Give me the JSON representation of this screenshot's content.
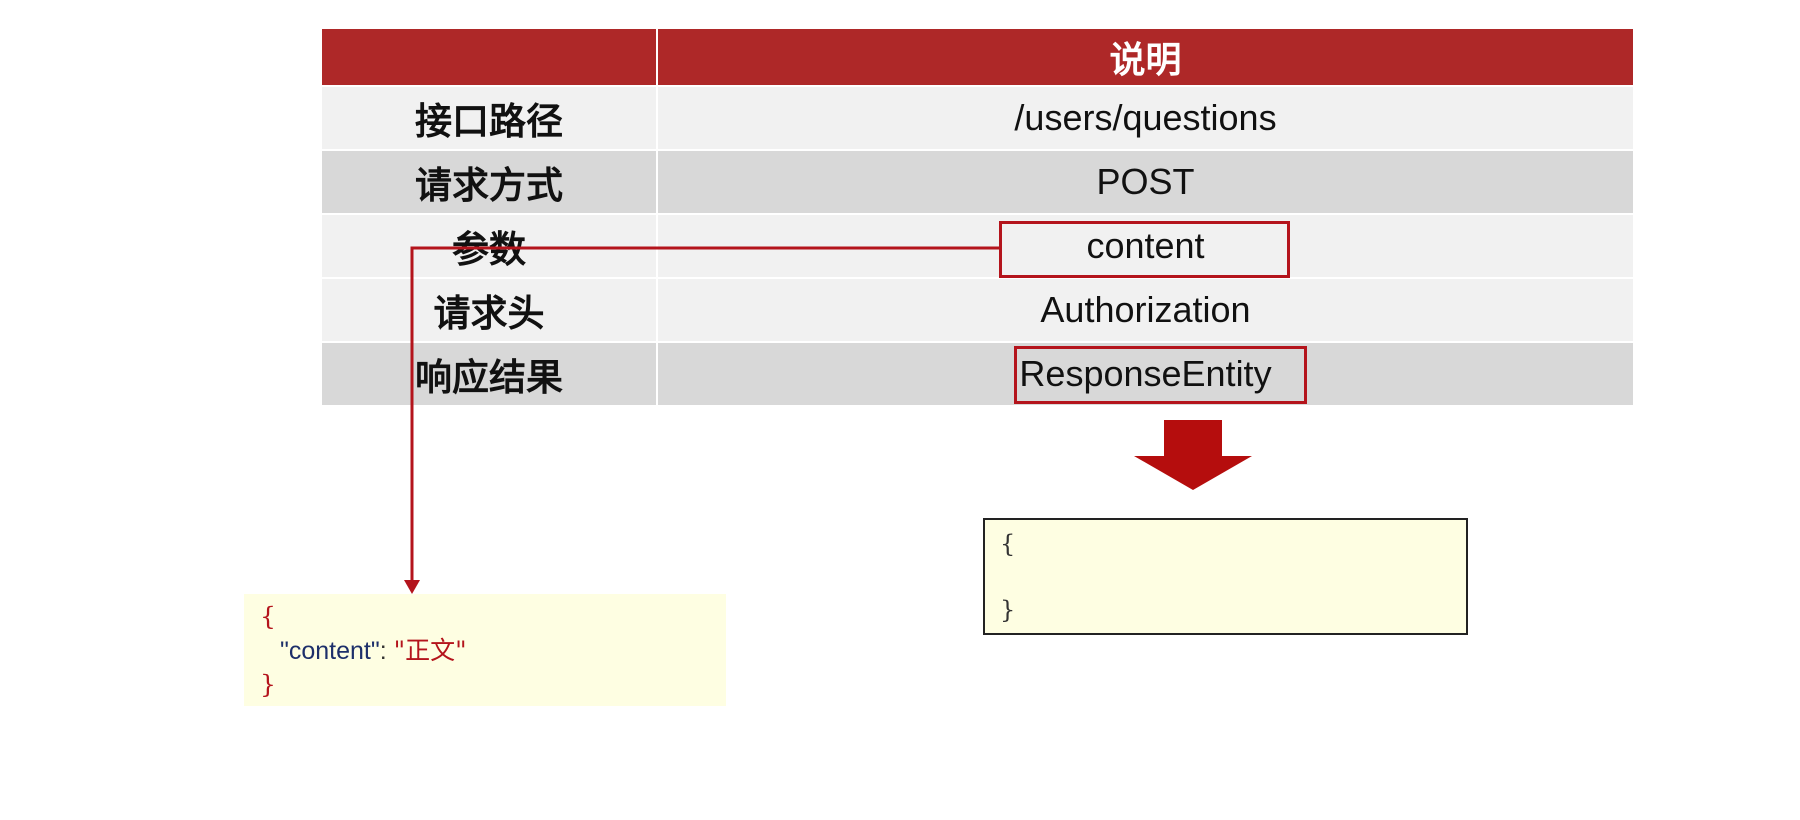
{
  "table": {
    "header_left": "",
    "header_right": "说明",
    "rows": [
      {
        "label": "接口路径",
        "value": "/users/questions"
      },
      {
        "label": "请求方式",
        "value": "POST"
      },
      {
        "label": "参数",
        "value": "content"
      },
      {
        "label": "请求头",
        "value": "Authorization"
      },
      {
        "label": "响应结果",
        "value": "ResponseEntity"
      }
    ]
  },
  "request_body": {
    "open_brace": "{",
    "key": "\"content\"",
    "colon": ": ",
    "value": "\"正文\"",
    "close_brace": "}"
  },
  "response_body": {
    "open_brace": "{",
    "close_brace": "}"
  },
  "colors": {
    "header_bg": "#ae2828",
    "accent_red": "#b4141c",
    "row_light": "#f1f1f1",
    "row_dark": "#d8d8d8",
    "code_bg": "#fefee2"
  }
}
